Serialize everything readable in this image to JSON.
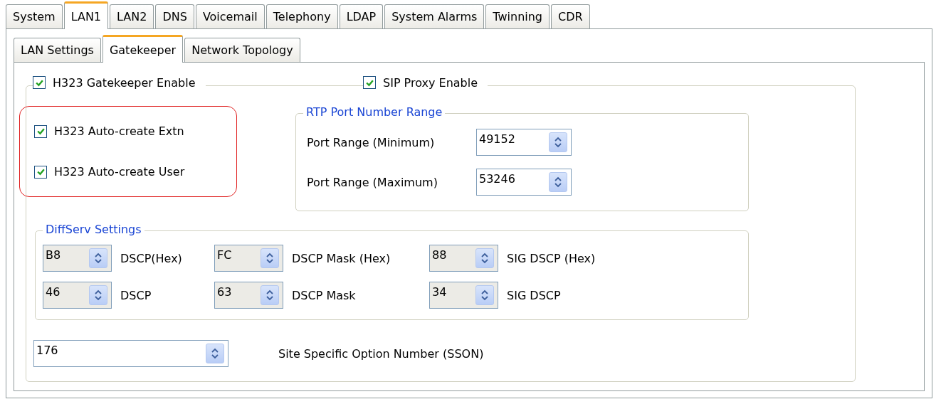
{
  "top_tabs": [
    {
      "label": "System",
      "selected": false
    },
    {
      "label": "LAN1",
      "selected": true
    },
    {
      "label": "LAN2",
      "selected": false
    },
    {
      "label": "DNS",
      "selected": false
    },
    {
      "label": "Voicemail",
      "selected": false
    },
    {
      "label": "Telephony",
      "selected": false
    },
    {
      "label": "LDAP",
      "selected": false
    },
    {
      "label": "System Alarms",
      "selected": false
    },
    {
      "label": "Twinning",
      "selected": false
    },
    {
      "label": "CDR",
      "selected": false
    }
  ],
  "sub_tabs": [
    {
      "label": "LAN Settings",
      "selected": false
    },
    {
      "label": "Gatekeeper",
      "selected": true
    },
    {
      "label": "Network Topology",
      "selected": false
    }
  ],
  "gatekeeper_enable": {
    "label": "H323 Gatekeeper Enable",
    "checked": true
  },
  "sip_proxy_enable": {
    "label": "SIP Proxy Enable",
    "checked": true
  },
  "auto_create": [
    {
      "label": "H323 Auto-create Extn",
      "checked": true
    },
    {
      "label": "H323 Auto-create User",
      "checked": true
    }
  ],
  "rtp_port_range": {
    "title": "RTP Port Number Range",
    "fields": [
      {
        "label": "Port Range (Minimum)",
        "value": "49152",
        "disabled": false
      },
      {
        "label": "Port Range (Maximum)",
        "value": "53246",
        "disabled": false
      }
    ]
  },
  "diffserv": {
    "title": "DiffServ Settings",
    "rows": [
      [
        {
          "spinner": {
            "value": "B8",
            "disabled": true
          },
          "caption": "DSCP(Hex)"
        },
        {
          "spinner": {
            "value": "FC",
            "disabled": true
          },
          "caption": "DSCP Mask (Hex)"
        },
        {
          "spinner": {
            "value": "88",
            "disabled": true
          },
          "caption": "SIG DSCP (Hex)"
        }
      ],
      [
        {
          "spinner": {
            "value": "46",
            "disabled": true
          },
          "caption": "DSCP"
        },
        {
          "spinner": {
            "value": "63",
            "disabled": true
          },
          "caption": "DSCP Mask"
        },
        {
          "spinner": {
            "value": "34",
            "disabled": true
          },
          "caption": "SIG DSCP"
        }
      ]
    ]
  },
  "sson": {
    "value": "176",
    "label": "Site Specific Option Number (SSON)",
    "disabled": false
  }
}
